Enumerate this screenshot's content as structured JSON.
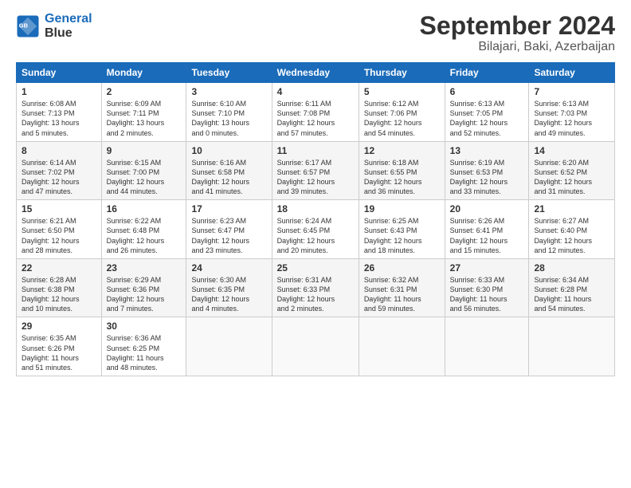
{
  "logo": {
    "line1": "General",
    "line2": "Blue"
  },
  "title": "September 2024",
  "subtitle": "Bilajari, Baki, Azerbaijan",
  "headers": [
    "Sunday",
    "Monday",
    "Tuesday",
    "Wednesday",
    "Thursday",
    "Friday",
    "Saturday"
  ],
  "weeks": [
    [
      {
        "day": "1",
        "content": "Sunrise: 6:08 AM\nSunset: 7:13 PM\nDaylight: 13 hours\nand 5 minutes."
      },
      {
        "day": "2",
        "content": "Sunrise: 6:09 AM\nSunset: 7:11 PM\nDaylight: 13 hours\nand 2 minutes."
      },
      {
        "day": "3",
        "content": "Sunrise: 6:10 AM\nSunset: 7:10 PM\nDaylight: 13 hours\nand 0 minutes."
      },
      {
        "day": "4",
        "content": "Sunrise: 6:11 AM\nSunset: 7:08 PM\nDaylight: 12 hours\nand 57 minutes."
      },
      {
        "day": "5",
        "content": "Sunrise: 6:12 AM\nSunset: 7:06 PM\nDaylight: 12 hours\nand 54 minutes."
      },
      {
        "day": "6",
        "content": "Sunrise: 6:13 AM\nSunset: 7:05 PM\nDaylight: 12 hours\nand 52 minutes."
      },
      {
        "day": "7",
        "content": "Sunrise: 6:13 AM\nSunset: 7:03 PM\nDaylight: 12 hours\nand 49 minutes."
      }
    ],
    [
      {
        "day": "8",
        "content": "Sunrise: 6:14 AM\nSunset: 7:02 PM\nDaylight: 12 hours\nand 47 minutes."
      },
      {
        "day": "9",
        "content": "Sunrise: 6:15 AM\nSunset: 7:00 PM\nDaylight: 12 hours\nand 44 minutes."
      },
      {
        "day": "10",
        "content": "Sunrise: 6:16 AM\nSunset: 6:58 PM\nDaylight: 12 hours\nand 41 minutes."
      },
      {
        "day": "11",
        "content": "Sunrise: 6:17 AM\nSunset: 6:57 PM\nDaylight: 12 hours\nand 39 minutes."
      },
      {
        "day": "12",
        "content": "Sunrise: 6:18 AM\nSunset: 6:55 PM\nDaylight: 12 hours\nand 36 minutes."
      },
      {
        "day": "13",
        "content": "Sunrise: 6:19 AM\nSunset: 6:53 PM\nDaylight: 12 hours\nand 33 minutes."
      },
      {
        "day": "14",
        "content": "Sunrise: 6:20 AM\nSunset: 6:52 PM\nDaylight: 12 hours\nand 31 minutes."
      }
    ],
    [
      {
        "day": "15",
        "content": "Sunrise: 6:21 AM\nSunset: 6:50 PM\nDaylight: 12 hours\nand 28 minutes."
      },
      {
        "day": "16",
        "content": "Sunrise: 6:22 AM\nSunset: 6:48 PM\nDaylight: 12 hours\nand 26 minutes."
      },
      {
        "day": "17",
        "content": "Sunrise: 6:23 AM\nSunset: 6:47 PM\nDaylight: 12 hours\nand 23 minutes."
      },
      {
        "day": "18",
        "content": "Sunrise: 6:24 AM\nSunset: 6:45 PM\nDaylight: 12 hours\nand 20 minutes."
      },
      {
        "day": "19",
        "content": "Sunrise: 6:25 AM\nSunset: 6:43 PM\nDaylight: 12 hours\nand 18 minutes."
      },
      {
        "day": "20",
        "content": "Sunrise: 6:26 AM\nSunset: 6:41 PM\nDaylight: 12 hours\nand 15 minutes."
      },
      {
        "day": "21",
        "content": "Sunrise: 6:27 AM\nSunset: 6:40 PM\nDaylight: 12 hours\nand 12 minutes."
      }
    ],
    [
      {
        "day": "22",
        "content": "Sunrise: 6:28 AM\nSunset: 6:38 PM\nDaylight: 12 hours\nand 10 minutes."
      },
      {
        "day": "23",
        "content": "Sunrise: 6:29 AM\nSunset: 6:36 PM\nDaylight: 12 hours\nand 7 minutes."
      },
      {
        "day": "24",
        "content": "Sunrise: 6:30 AM\nSunset: 6:35 PM\nDaylight: 12 hours\nand 4 minutes."
      },
      {
        "day": "25",
        "content": "Sunrise: 6:31 AM\nSunset: 6:33 PM\nDaylight: 12 hours\nand 2 minutes."
      },
      {
        "day": "26",
        "content": "Sunrise: 6:32 AM\nSunset: 6:31 PM\nDaylight: 11 hours\nand 59 minutes."
      },
      {
        "day": "27",
        "content": "Sunrise: 6:33 AM\nSunset: 6:30 PM\nDaylight: 11 hours\nand 56 minutes."
      },
      {
        "day": "28",
        "content": "Sunrise: 6:34 AM\nSunset: 6:28 PM\nDaylight: 11 hours\nand 54 minutes."
      }
    ],
    [
      {
        "day": "29",
        "content": "Sunrise: 6:35 AM\nSunset: 6:26 PM\nDaylight: 11 hours\nand 51 minutes."
      },
      {
        "day": "30",
        "content": "Sunrise: 6:36 AM\nSunset: 6:25 PM\nDaylight: 11 hours\nand 48 minutes."
      },
      {
        "day": "",
        "content": ""
      },
      {
        "day": "",
        "content": ""
      },
      {
        "day": "",
        "content": ""
      },
      {
        "day": "",
        "content": ""
      },
      {
        "day": "",
        "content": ""
      }
    ]
  ]
}
